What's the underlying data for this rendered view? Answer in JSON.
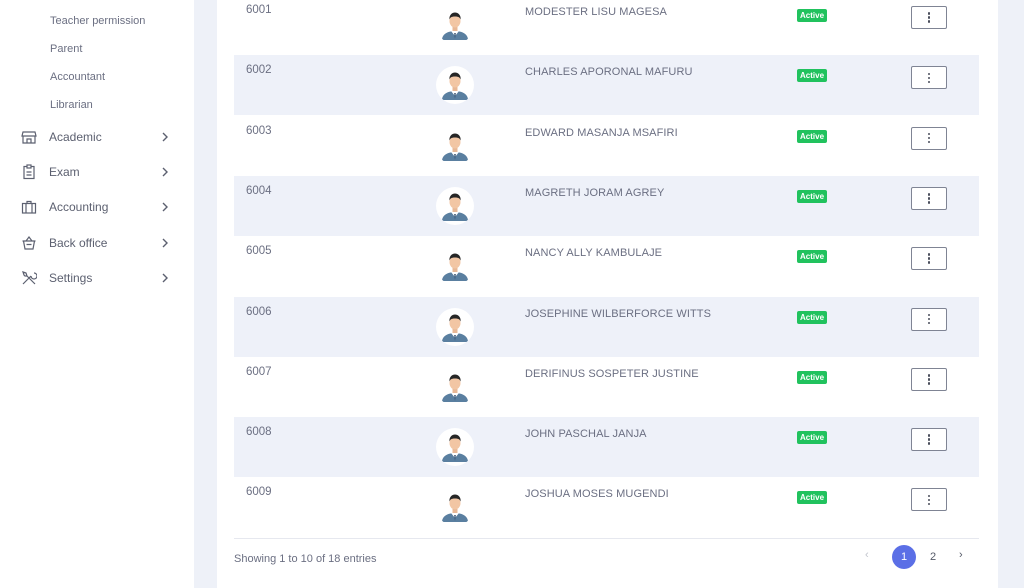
{
  "sidebar": {
    "sub_items": [
      "Teacher permission",
      "Parent",
      "Accountant",
      "Librarian"
    ],
    "menu": [
      {
        "label": "Academic",
        "icon": "store-icon"
      },
      {
        "label": "Exam",
        "icon": "clipboard-icon"
      },
      {
        "label": "Accounting",
        "icon": "briefcase-icon"
      },
      {
        "label": "Back office",
        "icon": "basket-icon"
      },
      {
        "label": "Settings",
        "icon": "tools-icon"
      }
    ]
  },
  "table": {
    "status_color": "#21c25e",
    "rows": [
      {
        "id": "6001",
        "name": "MODESTER LISU MAGESA",
        "status": "Active"
      },
      {
        "id": "6002",
        "name": "CHARLES APORONAL MAFURU",
        "status": "Active"
      },
      {
        "id": "6003",
        "name": "EDWARD MASANJA MSAFIRI",
        "status": "Active"
      },
      {
        "id": "6004",
        "name": "MAGRETH JORAM AGREY",
        "status": "Active"
      },
      {
        "id": "6005",
        "name": "NANCY ALLY KAMBULAJE",
        "status": "Active"
      },
      {
        "id": "6006",
        "name": "JOSEPHINE WILBERFORCE WITTS",
        "status": "Active"
      },
      {
        "id": "6007",
        "name": "DERIFINUS SOSPETER JUSTINE",
        "status": "Active"
      },
      {
        "id": "6008",
        "name": "JOHN PASCHAL JANJA",
        "status": "Active"
      },
      {
        "id": "6009",
        "name": "JOSHUA MOSES MUGENDI",
        "status": "Active"
      }
    ]
  },
  "footer": {
    "info": "Showing 1 to 10 of 18 entries",
    "pager": {
      "prev": "‹",
      "page1": "1",
      "page2": "2",
      "next": "›"
    },
    "accent_color": "#5b6fe6"
  }
}
